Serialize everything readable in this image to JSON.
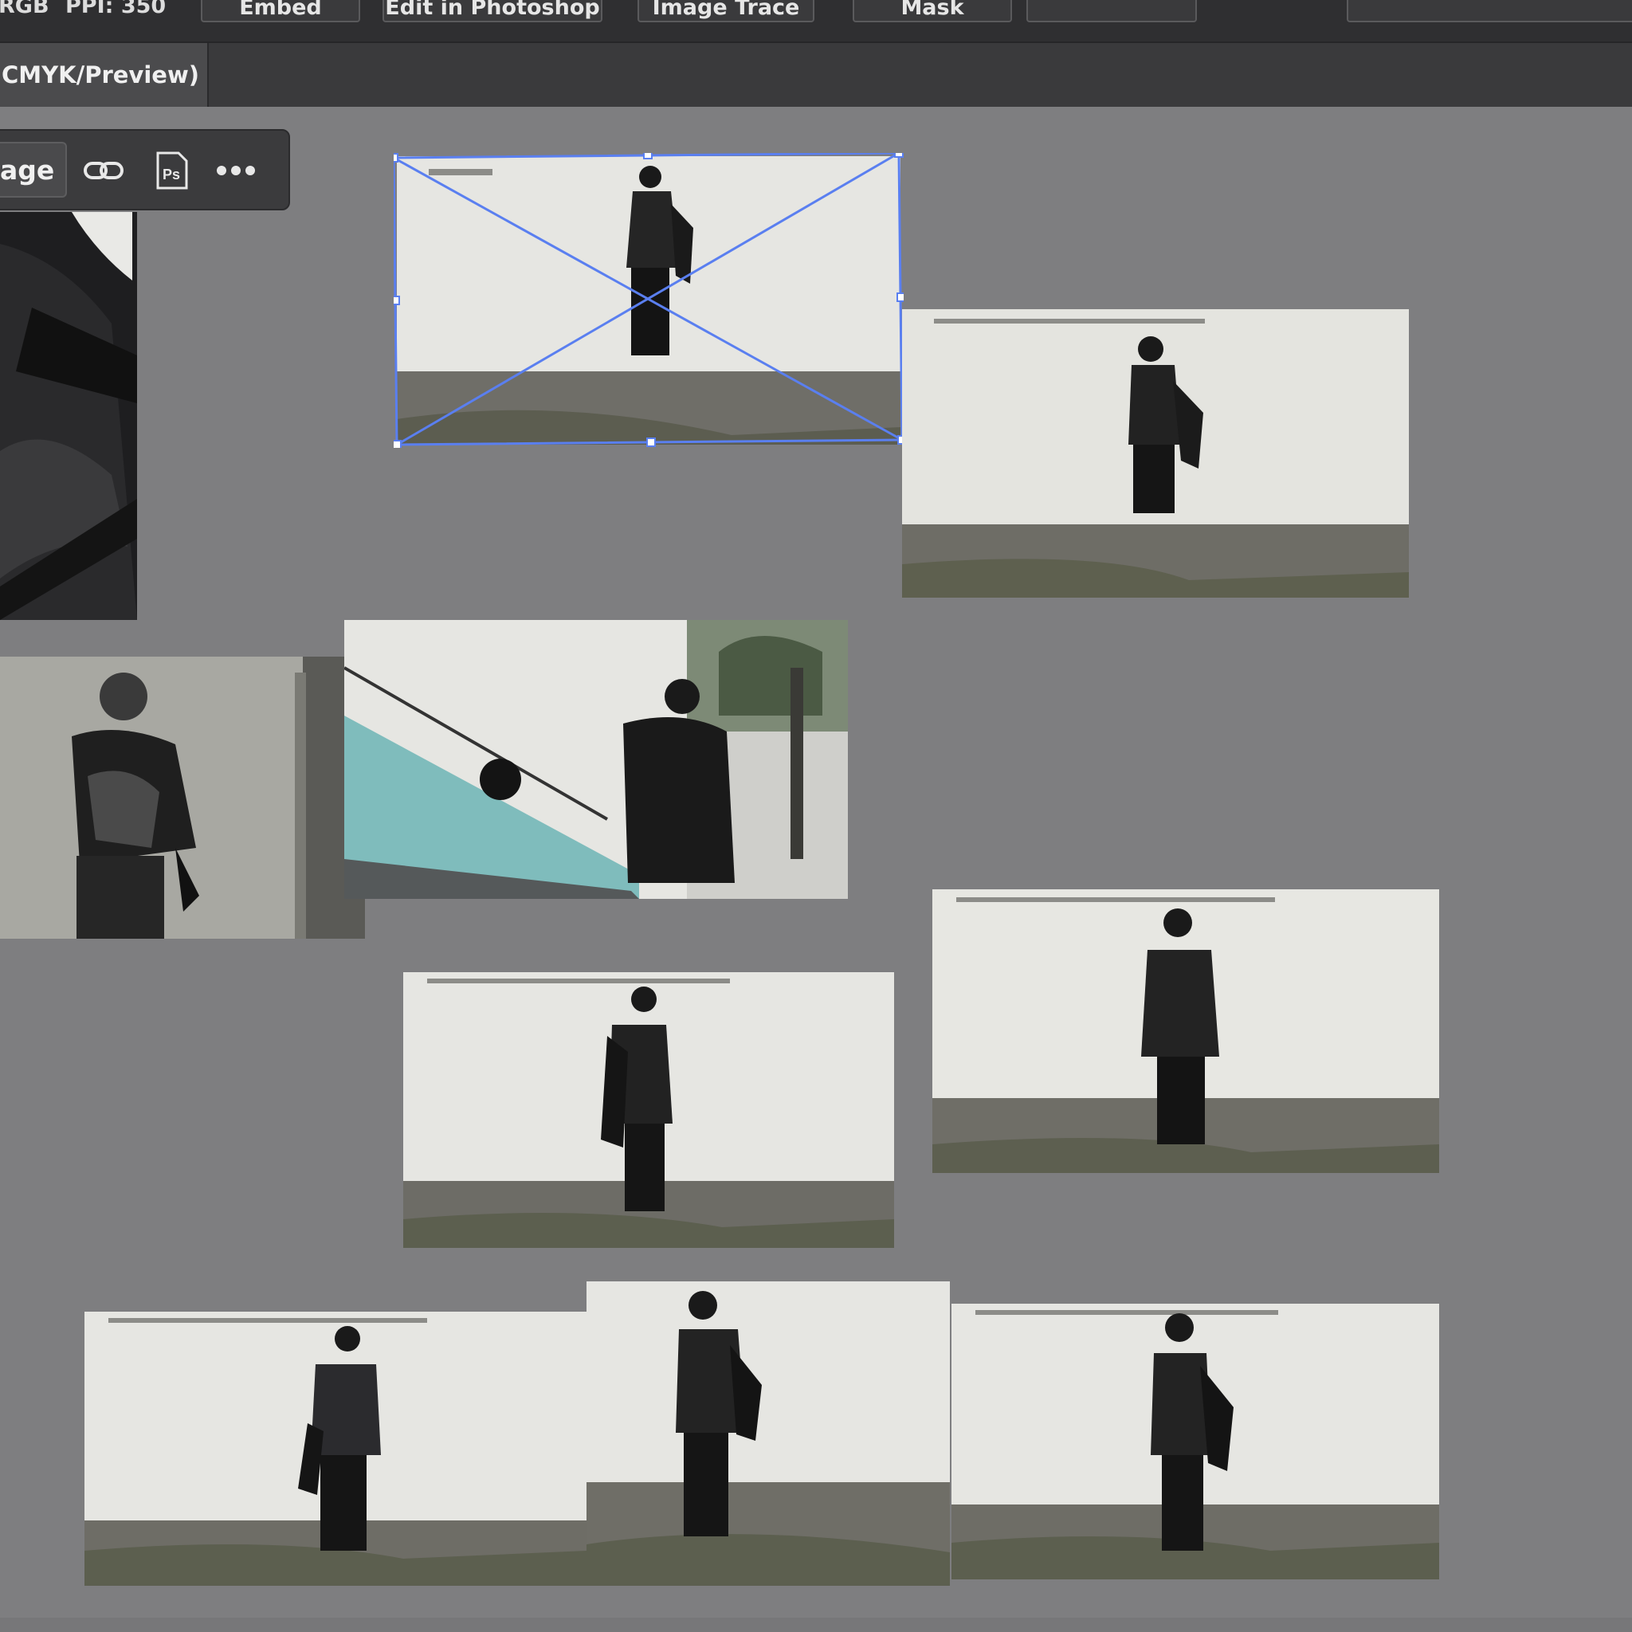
{
  "control_bar": {
    "color_mode": "RGB",
    "ppi": "PPI: 350",
    "buttons": [
      "Embed",
      "Edit in Photoshop",
      "Image Trace",
      "Mask",
      ""
    ]
  },
  "document_tab": {
    "title_fragment": "CMYK/Preview)"
  },
  "context_bar": {
    "image_label": "age",
    "icons": [
      "link-icon",
      "photoshop-icon",
      "more-icon"
    ],
    "ps_glyph": "Ps"
  },
  "colors": {
    "canvas": "#7e7e80",
    "selection": "#5a7ff0",
    "toolbar": "#2f2f31"
  },
  "photos": [
    {
      "name": "jacket-closeup",
      "selected": false
    },
    {
      "name": "standing-front",
      "selected": true
    },
    {
      "name": "walking-back-right",
      "selected": false
    },
    {
      "name": "leaning-wall-beanie",
      "selected": false
    },
    {
      "name": "stairway-two-people",
      "selected": false
    },
    {
      "name": "standing-back-center",
      "selected": false
    },
    {
      "name": "standing-back-left",
      "selected": false
    },
    {
      "name": "standing-side-front",
      "selected": false
    },
    {
      "name": "standing-back-turned",
      "selected": false
    },
    {
      "name": "standing-back-jacket",
      "selected": false
    }
  ]
}
